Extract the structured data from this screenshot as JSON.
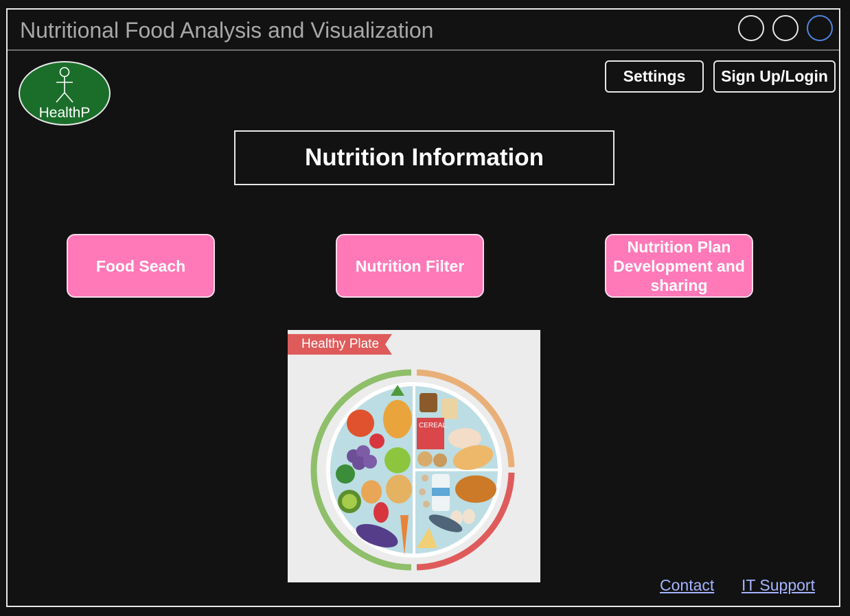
{
  "window": {
    "title": "Nutritional Food Analysis and Visualization",
    "controls": [
      "circle-button",
      "circle-button",
      "circle-button-active"
    ]
  },
  "logo": {
    "text": "HealthP",
    "icon": "stick-figure-icon",
    "color": "#1a6e2a"
  },
  "header": {
    "settings_label": "Settings",
    "signup_label": "Sign Up/Login"
  },
  "main": {
    "section_title": "Nutrition Information",
    "cards": [
      {
        "label": "Food Seach"
      },
      {
        "label": "Nutrition Filter"
      },
      {
        "label": "Nutrition Plan Development and sharing"
      }
    ],
    "card_color": "#ff78b8",
    "image": {
      "banner_text": "Healthy Plate",
      "plate_label": "CEREAL"
    }
  },
  "footer": {
    "contact_label": "Contact",
    "itsupport_label": "IT Support",
    "link_color": "#a6b4ff"
  }
}
